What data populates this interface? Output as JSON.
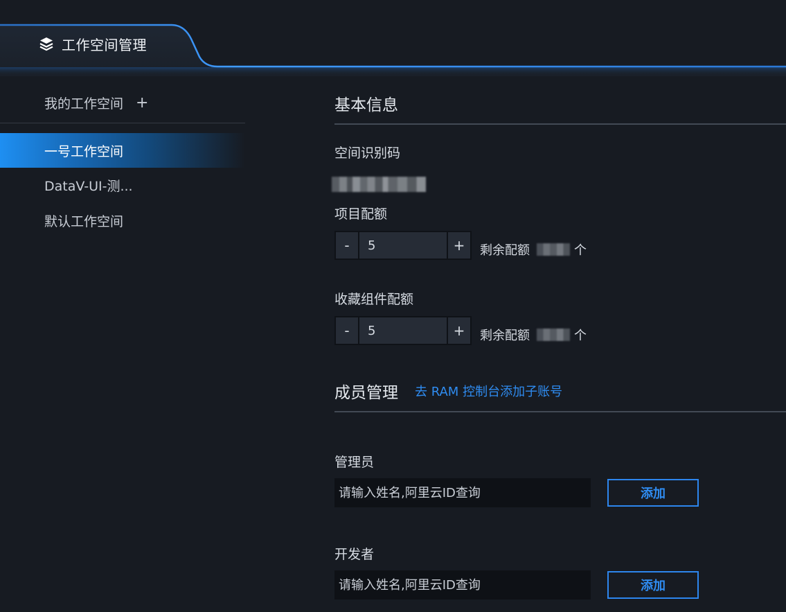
{
  "header": {
    "title": "工作空间管理",
    "icon": "layers-icon"
  },
  "sidebar": {
    "heading": "我的工作空间",
    "add_label": "+",
    "items": [
      {
        "label": "一号工作空间",
        "active": true
      },
      {
        "label": "DataV-UI-测..."
      },
      {
        "label": "默认工作空间"
      }
    ]
  },
  "basic_info": {
    "title": "基本信息",
    "space_code_label": "空间识别码",
    "project_quota": {
      "label": "项目配额",
      "value": "5",
      "minus": "-",
      "plus": "+",
      "remain_label": "剩余配额",
      "unit": "个"
    },
    "component_quota": {
      "label": "收藏组件配额",
      "value": "5",
      "minus": "-",
      "plus": "+",
      "remain_label": "剩余配额",
      "unit": "个"
    }
  },
  "members": {
    "title": "成员管理",
    "ram_link": "去 RAM 控制台添加子账号",
    "admin": {
      "label": "管理员",
      "placeholder": "请输入姓名,阿里云ID查询",
      "add_label": "添加"
    },
    "developer": {
      "label": "开发者",
      "placeholder": "请输入姓名,阿里云ID查询",
      "add_label": "添加"
    }
  },
  "colors": {
    "background": "#171b22",
    "accent": "#2f8cf1",
    "active_item": "#1e8ff2"
  }
}
